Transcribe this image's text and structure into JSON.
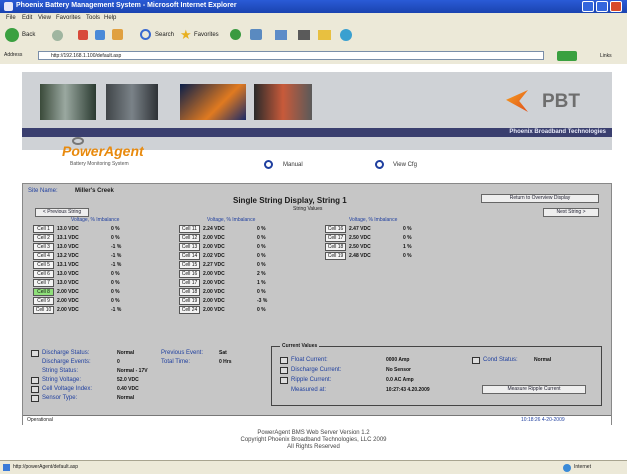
{
  "window": {
    "title": "Phoenix Battery Management System - Microsoft Internet Explorer"
  },
  "menu": [
    "File",
    "Edit",
    "View",
    "Favorites",
    "Tools",
    "Help"
  ],
  "toolbar": {
    "back": "Back",
    "search": "Search",
    "favorites": "Favorites"
  },
  "address": {
    "label": "Address",
    "url": "http://192.168.1.100/default.asp",
    "go": "Go",
    "links": "Links"
  },
  "banner": {
    "brand": "PBT",
    "tagline": "Phoenix Broadband Technologies"
  },
  "app": {
    "name": "PowerAgent",
    "subtitle": "Battery Monitoring System",
    "nav": {
      "manual": "Manual",
      "view_cfg": "View Cfg"
    }
  },
  "panel": {
    "site_label": "Site Name:",
    "site_value": "Miller's Creek",
    "title": "Single String Display, String 1",
    "subtitle": "String Values",
    "back_btn": "Return to Overview Display",
    "prev_btn": "< Previous String",
    "next_btn": "Next String >",
    "col_headers": [
      "Voltage, % Imbalance",
      "Voltage, % Imbalance",
      "Voltage, % Imbalance"
    ],
    "cells": [
      [
        {
          "label": "Cell 1",
          "value": "13.0 VDC",
          "pct": "0 %"
        },
        {
          "label": "Cell 11",
          "value": "2.24 VDC",
          "pct": "0 %"
        },
        {
          "label": "Cell 16",
          "value": "2.47 VDC",
          "pct": "0 %"
        }
      ],
      [
        {
          "label": "Cell 2",
          "value": "13.1 VDC",
          "pct": "0 %"
        },
        {
          "label": "Cell 12",
          "value": "2.00 VDC",
          "pct": "0 %"
        },
        {
          "label": "Cell 17",
          "value": "2.50 VDC",
          "pct": "0 %"
        }
      ],
      [
        {
          "label": "Cell 3",
          "value": "13.0 VDC",
          "pct": "-1 %"
        },
        {
          "label": "Cell 13",
          "value": "2.00 VDC",
          "pct": "0 %"
        },
        {
          "label": "Cell 18",
          "value": "2.50 VDC",
          "pct": "1 %"
        }
      ],
      [
        {
          "label": "Cell 4",
          "value": "13.2 VDC",
          "pct": "-1 %"
        },
        {
          "label": "Cell 14",
          "value": "2.02 VDC",
          "pct": "0 %"
        },
        {
          "label": "Cell 19",
          "value": "2.48 VDC",
          "pct": "0 %"
        }
      ],
      [
        {
          "label": "Cell 5",
          "value": "13.1 VDC",
          "pct": "-1 %"
        },
        {
          "label": "Cell 15",
          "value": "2.27 VDC",
          "pct": "0 %"
        }
      ],
      [
        {
          "label": "Cell 6",
          "value": "13.0 VDC",
          "pct": "0 %"
        },
        {
          "label": "Cell 16",
          "value": "2.00 VDC",
          "pct": "2 %"
        }
      ],
      [
        {
          "label": "Cell 7",
          "value": "13.0 VDC",
          "pct": "0 %"
        },
        {
          "label": "Cell 17",
          "value": "2.00 VDC",
          "pct": "1 %"
        }
      ],
      [
        {
          "label": "Cell 8",
          "value": "2.00 VDC",
          "pct": "0 %"
        },
        {
          "label": "Cell 18",
          "value": "2.00 VDC",
          "pct": "0 %"
        }
      ],
      [
        {
          "label": "Cell 9",
          "value": "2.00 VDC",
          "pct": "0 %"
        },
        {
          "label": "Cell 19",
          "value": "2.00 VDC",
          "pct": "-3 %"
        }
      ],
      [
        {
          "label": "Cell 10",
          "value": "2.00 VDC",
          "pct": "-1 %"
        },
        {
          "label": "Cell 24",
          "value": "2.00 VDC",
          "pct": "0 %"
        }
      ]
    ],
    "status": [
      {
        "label": "Discharge Status:",
        "value": "Normal"
      },
      {
        "label": "Discharge Events:",
        "value": "0"
      },
      {
        "label": "String Status:",
        "value": "Normal - 17V"
      },
      {
        "label": "String Voltage:",
        "value": "52.0 VDC"
      },
      {
        "label": "Cell Voltage Index:",
        "value": "0.40 VDC"
      },
      {
        "label": "Sensor Type:",
        "value": "Normal"
      }
    ],
    "extra": {
      "last_event_label": "Previous Event:",
      "last_event_value": "Sat",
      "total_label": "Total Time:",
      "total_value": "0 Hrs"
    },
    "group": {
      "title": "Current Values",
      "rows": [
        {
          "label": "Float Current:",
          "value": "0000 Amp"
        },
        {
          "label": "Discharge Current:",
          "value": "No Sensor"
        },
        {
          "label": "Ripple Current:",
          "value": "0.0 AC Amp"
        },
        {
          "label": "Measured at:",
          "value": "10:27:43 4.20.2009"
        }
      ],
      "cond_label": "Cond Status:",
      "cond_value": "Normal",
      "measure_btn": "Measure Ripple Current"
    },
    "status_bar_text": "Operational",
    "status_bar_time": "10:18:26  4-20-2009"
  },
  "footer": [
    "PowerAgent BMS Web Server Version 1.2",
    "Copyright Phoenix Broadband Technologies, LLC 2009",
    "All Rights Reserved"
  ],
  "ie_status": {
    "left": "http://powerAgent/default.asp",
    "right": "Internet"
  },
  "colors": {
    "title_bar": "#1a43b0",
    "brand_orange": "#e88a0e",
    "panel_bg": "#c6c6c6",
    "active_cell": "#8fe07a",
    "banner_strip": "#3a3f6f"
  }
}
